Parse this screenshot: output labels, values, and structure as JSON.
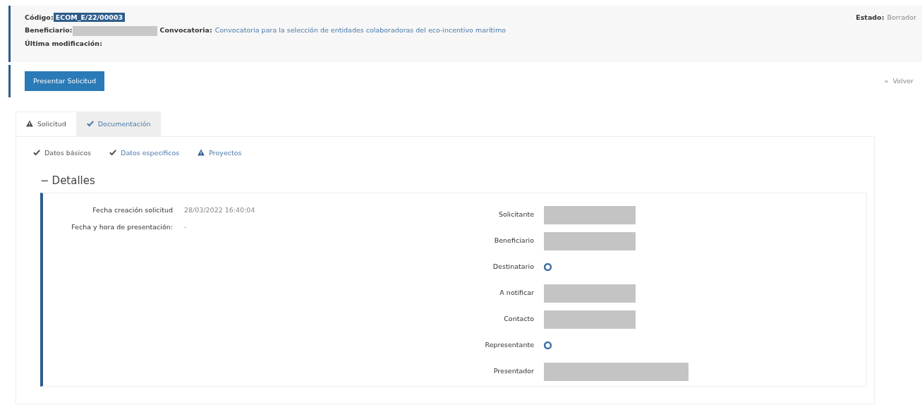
{
  "header": {
    "codigo": {
      "label": "Código:",
      "value": "ECOM_E/22/00003"
    },
    "beneficiario": {
      "label": "Beneficiario:",
      "redacted": true
    },
    "convocatoria": {
      "label": "Convocatoria:",
      "value": "Convocatoria para la selección de entidades colaboradoras del eco-incentivo marítimo"
    },
    "ultima_modificacion": {
      "label": "Última modificación:"
    },
    "estado": {
      "label": "Estado:",
      "value": "Borrador"
    }
  },
  "actions": {
    "primary": "Presentar Solicitud",
    "back": {
      "icon": "«",
      "label": "Volver"
    }
  },
  "tabs": [
    {
      "label": "Solicitud",
      "kind": "warning",
      "selected": true
    },
    {
      "label": "Documentación",
      "kind": "check",
      "selected": false
    }
  ],
  "subtabs": [
    {
      "label": "Datos básicos",
      "kind": "check",
      "selected": true
    },
    {
      "label": "Datos específicos",
      "kind": "check",
      "selected": false
    },
    {
      "label": "Proyectos",
      "kind": "warning",
      "selected": false
    }
  ],
  "section": {
    "collapse_icon": "−",
    "title": "Detalles"
  },
  "left_fields": [
    {
      "label": "Fecha creación solicitud",
      "value": "28/03/2022 16:40:04"
    },
    {
      "label": "Fecha y hora de presentación:",
      "value": "-"
    }
  ],
  "right_fields": [
    {
      "label": "Solicitante",
      "kind": "redacted"
    },
    {
      "label": "Beneficiario",
      "kind": "redacted"
    },
    {
      "label": "Destinatario",
      "kind": "add"
    },
    {
      "label": "A notificar",
      "kind": "redacted"
    },
    {
      "label": "Contacto",
      "kind": "redacted"
    },
    {
      "label": "Representante",
      "kind": "add"
    },
    {
      "label": "Presentador",
      "kind": "redacted_wide"
    }
  ]
}
